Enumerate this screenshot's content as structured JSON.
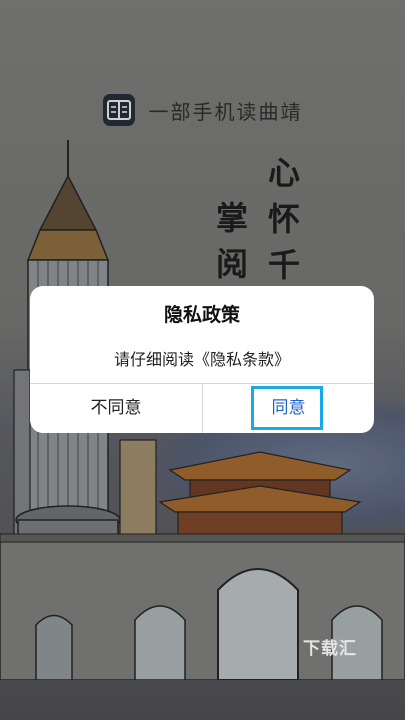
{
  "splash": {
    "slogan": "一部手机读曲靖",
    "poem_column_1": "心怀千",
    "poem_column_2": "掌阅",
    "watermark": "下载汇",
    "logo_icon": "book-icon"
  },
  "dialog": {
    "title": "隐私政策",
    "message": "请仔细阅读《隐私条款》",
    "decline_label": "不同意",
    "agree_label": "同意"
  },
  "colors": {
    "agree_text": "#1f62c8",
    "highlight": "#1aa8e8",
    "dialog_bg": "#ffffff"
  }
}
